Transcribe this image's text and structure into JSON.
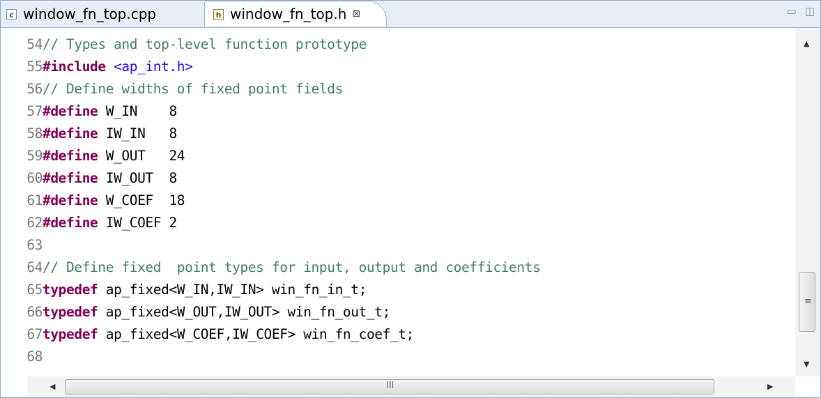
{
  "tabs": [
    {
      "icon": "c-source-file-icon",
      "icon_glyph": "c",
      "label": "window_fn_top.cpp",
      "active": false
    },
    {
      "icon": "header-file-icon",
      "icon_glyph": "h",
      "label": "window_fn_top.h",
      "active": true,
      "close_glyph": "⊠"
    }
  ],
  "window_controls": {
    "minimize": "▭",
    "maximize": "◫"
  },
  "editor": {
    "lines": [
      {
        "num": "54",
        "parts": [
          {
            "t": "cm",
            "v": "// Types and top-level function prototype"
          }
        ]
      },
      {
        "num": "55",
        "parts": [
          {
            "t": "kw",
            "v": "#include"
          },
          {
            "t": "code",
            "v": " "
          },
          {
            "t": "str",
            "v": "<ap_int.h>"
          }
        ]
      },
      {
        "num": "56",
        "parts": [
          {
            "t": "cm",
            "v": "// Define widths of fixed point fields"
          }
        ]
      },
      {
        "num": "57",
        "parts": [
          {
            "t": "kw",
            "v": "#define"
          },
          {
            "t": "code",
            "v": " W_IN    8"
          }
        ]
      },
      {
        "num": "58",
        "parts": [
          {
            "t": "kw",
            "v": "#define"
          },
          {
            "t": "code",
            "v": " IW_IN   8"
          }
        ]
      },
      {
        "num": "59",
        "parts": [
          {
            "t": "kw",
            "v": "#define"
          },
          {
            "t": "code",
            "v": " W_OUT   24"
          }
        ]
      },
      {
        "num": "60",
        "parts": [
          {
            "t": "kw",
            "v": "#define"
          },
          {
            "t": "code",
            "v": " IW_OUT  8"
          }
        ]
      },
      {
        "num": "61",
        "parts": [
          {
            "t": "kw",
            "v": "#define"
          },
          {
            "t": "code",
            "v": " W_COEF  18"
          }
        ]
      },
      {
        "num": "62",
        "parts": [
          {
            "t": "kw",
            "v": "#define"
          },
          {
            "t": "code",
            "v": " IW_COEF 2"
          }
        ]
      },
      {
        "num": "63",
        "parts": []
      },
      {
        "num": "64",
        "parts": [
          {
            "t": "cm",
            "v": "// Define fixed  point types for input, output and coefficients"
          }
        ]
      },
      {
        "num": "65",
        "parts": [
          {
            "t": "kw",
            "v": "typedef"
          },
          {
            "t": "code",
            "v": " ap_fixed<W_IN,IW_IN> win_fn_in_t;"
          }
        ]
      },
      {
        "num": "66",
        "parts": [
          {
            "t": "kw",
            "v": "typedef"
          },
          {
            "t": "code",
            "v": " ap_fixed<W_OUT,IW_OUT> win_fn_out_t;"
          }
        ]
      },
      {
        "num": "67",
        "parts": [
          {
            "t": "kw",
            "v": "typedef"
          },
          {
            "t": "code",
            "v": " ap_fixed<W_COEF,IW_COEF> win_fn_coef_t;"
          }
        ]
      },
      {
        "num": "68",
        "parts": []
      }
    ]
  },
  "scrollbar": {
    "up_arrow": "▲",
    "down_arrow": "▼",
    "left_arrow": "◀",
    "right_arrow": "▶",
    "grip_v": "≡",
    "grip_h": "III"
  }
}
